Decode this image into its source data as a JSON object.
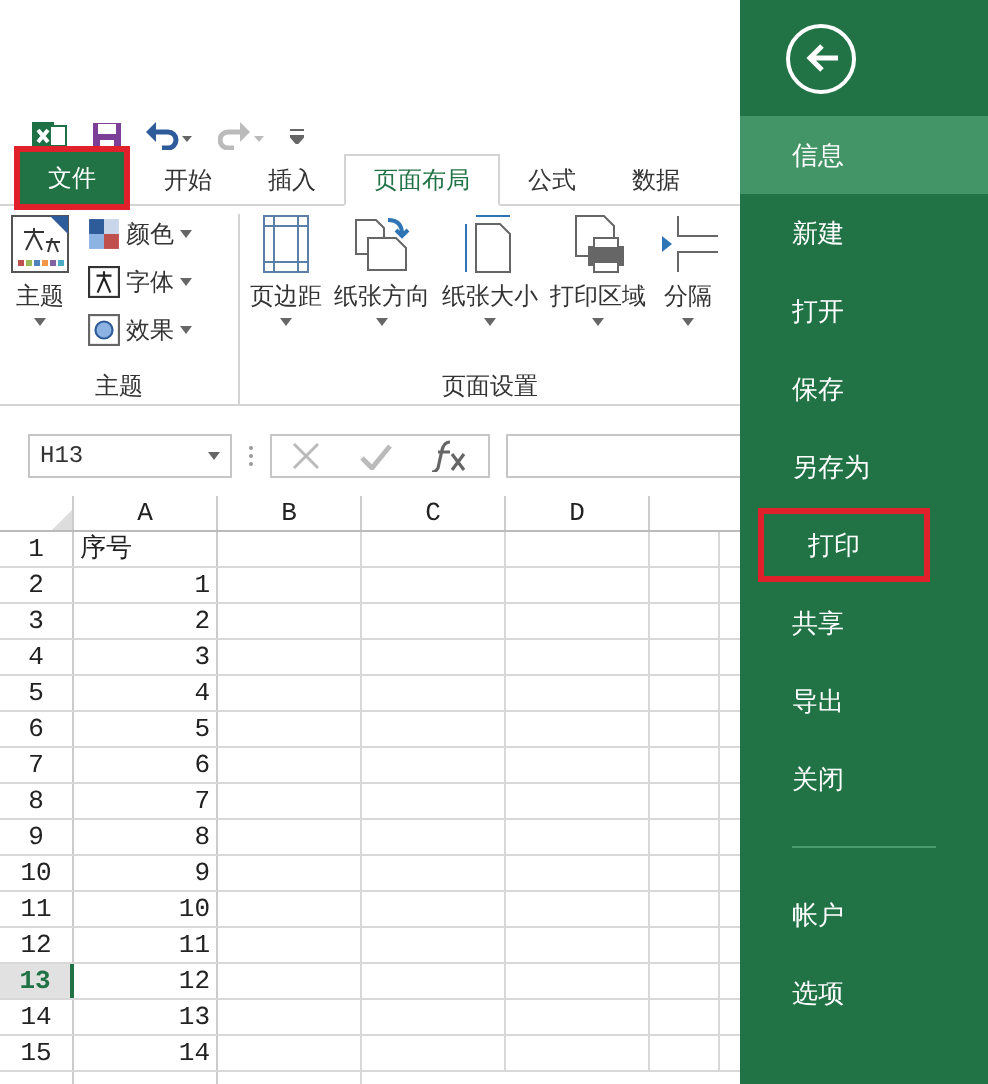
{
  "tabs": [
    {
      "label": "文件",
      "kind": "file",
      "selected": false,
      "highlighted": true
    },
    {
      "label": "开始",
      "kind": "tab",
      "selected": false,
      "highlighted": false
    },
    {
      "label": "插入",
      "kind": "tab",
      "selected": false,
      "highlighted": false
    },
    {
      "label": "页面布局",
      "kind": "tab",
      "selected": true,
      "highlighted": false
    },
    {
      "label": "公式",
      "kind": "tab",
      "selected": false,
      "highlighted": false
    },
    {
      "label": "数据",
      "kind": "tab",
      "selected": false,
      "highlighted": false
    }
  ],
  "ribbon": {
    "groups": [
      {
        "title": "主题",
        "big": [
          {
            "label": "主题",
            "kind": "theme"
          }
        ],
        "small": [
          {
            "label": "颜色",
            "kind": "colors"
          },
          {
            "label": "字体",
            "kind": "fonts"
          },
          {
            "label": "效果",
            "kind": "effects"
          }
        ]
      },
      {
        "title": "页面设置",
        "big": [
          {
            "label": "页边距",
            "kind": "margins"
          },
          {
            "label": "纸张方向",
            "kind": "orientation"
          },
          {
            "label": "纸张大小",
            "kind": "size"
          },
          {
            "label": "打印区域",
            "kind": "printarea"
          },
          {
            "label": "分隔",
            "kind": "breaks"
          }
        ]
      }
    ]
  },
  "name_box": {
    "value": "H13"
  },
  "columns": [
    "A",
    "B",
    "C",
    "D"
  ],
  "rows": [
    {
      "number": "1",
      "a": "序号",
      "kind": "text",
      "selected": false
    },
    {
      "number": "2",
      "a": "1",
      "kind": "number",
      "selected": false
    },
    {
      "number": "3",
      "a": "2",
      "kind": "number",
      "selected": false
    },
    {
      "number": "4",
      "a": "3",
      "kind": "number",
      "selected": false
    },
    {
      "number": "5",
      "a": "4",
      "kind": "number",
      "selected": false
    },
    {
      "number": "6",
      "a": "5",
      "kind": "number",
      "selected": false
    },
    {
      "number": "7",
      "a": "6",
      "kind": "number",
      "selected": false
    },
    {
      "number": "8",
      "a": "7",
      "kind": "number",
      "selected": false
    },
    {
      "number": "9",
      "a": "8",
      "kind": "number",
      "selected": false
    },
    {
      "number": "10",
      "a": "9",
      "kind": "number",
      "selected": false
    },
    {
      "number": "11",
      "a": "10",
      "kind": "number",
      "selected": false
    },
    {
      "number": "12",
      "a": "11",
      "kind": "number",
      "selected": false
    },
    {
      "number": "13",
      "a": "12",
      "kind": "number",
      "selected": true
    },
    {
      "number": "14",
      "a": "13",
      "kind": "number",
      "selected": false
    },
    {
      "number": "15",
      "a": "14",
      "kind": "number",
      "selected": false
    }
  ],
  "backstage": {
    "items": [
      {
        "label": "信息",
        "selected": true,
        "highlighted": false
      },
      {
        "label": "新建",
        "selected": false,
        "highlighted": false
      },
      {
        "label": "打开",
        "selected": false,
        "highlighted": false
      },
      {
        "label": "保存",
        "selected": false,
        "highlighted": false
      },
      {
        "label": "另存为",
        "selected": false,
        "highlighted": false
      },
      {
        "label": "打印",
        "selected": false,
        "highlighted": true
      },
      {
        "label": "共享",
        "selected": false,
        "highlighted": false
      },
      {
        "label": "导出",
        "selected": false,
        "highlighted": false
      },
      {
        "label": "关闭",
        "selected": false,
        "highlighted": false
      }
    ],
    "bottom_items": [
      {
        "label": "帐户",
        "selected": false
      },
      {
        "label": "选项",
        "selected": false
      }
    ]
  }
}
